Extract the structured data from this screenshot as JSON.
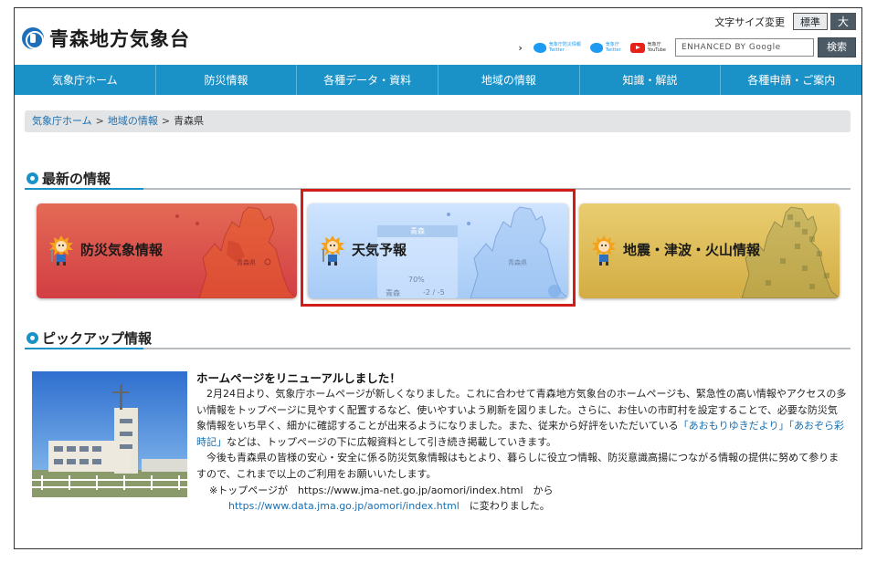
{
  "header": {
    "site_title": "青森地方気象台",
    "font_size_label": "文字サイズ変更",
    "font_standard": "標準",
    "font_large": "大",
    "sns": [
      {
        "name": "気象庁防災情報",
        "sub": "Twitter"
      },
      {
        "name": "気象庁",
        "sub": "Twitter"
      },
      {
        "name": "気象庁",
        "sub": "YouTube"
      }
    ],
    "search_placeholder": "ENHANCED BY Google",
    "search_button": "検索"
  },
  "nav": {
    "items": [
      "気象庁ホーム",
      "防災情報",
      "各種データ・資料",
      "地域の情報",
      "知識・解説",
      "各種申請・ご案内"
    ]
  },
  "breadcrumb": {
    "items": [
      "気象庁ホーム",
      "地域の情報"
    ],
    "current": "青森県",
    "separator": ">"
  },
  "latest": {
    "heading": "最新の情報",
    "cards": [
      {
        "title": "防災気象情報",
        "map_label": "青森県"
      },
      {
        "title": "天気予報",
        "map_label": "青森県",
        "panel_head": "青森",
        "pop": "70%",
        "city": "青森",
        "temps": "-2 / -5"
      },
      {
        "title": "地震・津波・火山情報"
      }
    ]
  },
  "pickup": {
    "heading": "ピックアップ情報",
    "article_title": "ホームページをリニューアルしました！",
    "p1_a": "2月24日より、気象庁ホームページが新しくなりました。これに合わせて青森地方気象台のホームページも、緊急性の高い情報やアクセスの多い情報をトップページに見やすく配置するなど、使いやすいよう刷新を図りました。さらに、お住いの市町村を設定することで、必要な防災気象情報をいち早く、細かに確認することが出来るようになりました。また、従来から好評をいただいている",
    "p1_link1": "「あおもりゆきだより」",
    "p1_link2": "「あおぞら彩時記」",
    "p1_b": "などは、トップページの下に広報資料として引き続き掲載していきます。",
    "p2": "今後も青森県の皆様の安心・安全に係る防災気象情報はもとより、暮らしに役立つ情報、防災意識高揚につながる情報の提供に努めて参りますので、これまで以上のご利用をお願いいたします。",
    "url_note_prefix": "※トップページが　https://www.jma-net.go.jp/aomori/index.html　から",
    "new_url": "https://www.data.jma.go.jp/aomori/index.html",
    "url_note_suffix": "　に変わりました。"
  },
  "colors": {
    "nav_blue": "#1a91c7",
    "highlight_red": "#d11c1c",
    "link_blue": "#1a6fb0"
  }
}
